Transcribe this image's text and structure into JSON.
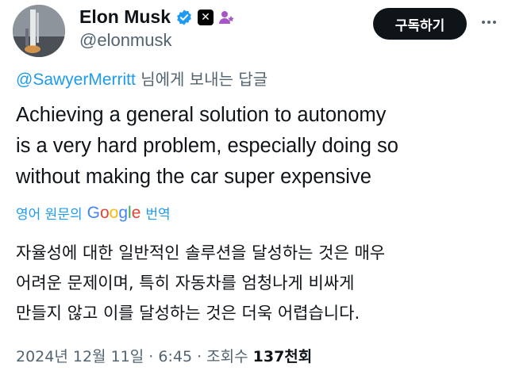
{
  "author": {
    "display_name": "Elon Musk",
    "handle": "@elonmusk",
    "badges": [
      "verified-badge-icon",
      "x-logo-icon",
      "affiliation-icon"
    ]
  },
  "actions": {
    "subscribe_label": "구독하기",
    "more_icon": "more-icon"
  },
  "reply": {
    "mention": "@SawyerMerritt",
    "suffix": " 님에게 보내는 답글"
  },
  "tweet": {
    "lines": [
      "Achieving a general solution to autonomy",
      "is a very hard problem, especially doing so",
      "without making the car super expensive"
    ]
  },
  "translation": {
    "prefix": "영어 원문의",
    "provider": "Google",
    "suffix": "번역",
    "lines": [
      "자율성에 대한 일반적인 솔루션을 달성하는 것은 매우",
      "어려운 문제이며, 특히 자동차를 엄청나게 비싸게",
      "만들지 않고 이를 달성하는 것은 더욱 어렵습니다."
    ]
  },
  "meta": {
    "date": "2024년 12월 11일",
    "sep1": " · ",
    "time": "6:45",
    "sep2": " · ",
    "views_label": "조회수 ",
    "views_value": "137천회"
  },
  "colors": {
    "accent": "#1d9bf0",
    "text": "#0f1419",
    "secondary": "#536471",
    "affiliation": "#a855c8"
  }
}
